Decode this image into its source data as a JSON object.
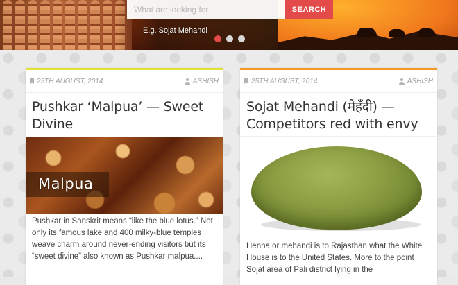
{
  "search": {
    "placeholder": "What are looking for",
    "button_label": "SEARCH",
    "example": "E.g. Sojat Mehandi"
  },
  "slider": {
    "dots": 3,
    "active_index": 0
  },
  "colors": {
    "accent_red": "#e34a4a",
    "card_left_border": "#e2e138",
    "card_right_border": "#f39a27"
  },
  "posts": [
    {
      "date": "25TH AUGUST, 2014",
      "author": "ASHISH",
      "title": "Pushkar ‘Malpua’ — Sweet Divine",
      "image_caption": "Malpua",
      "excerpt": "Pushkar in Sanskrit means “like the blue lotus.” Not only its famous lake and 400 milky-blue temples weave charm around never-ending visitors but its “sweet divine” also known as Pushkar malpua...."
    },
    {
      "date": "25TH AUGUST, 2014",
      "author": "ASHISH",
      "title": "Sojat Mehandi (मेहँदी) — Competitors red with envy",
      "excerpt": "Henna or mehandi is to Rajasthan what the White House is to the United States. More to the point Sojat area of Pali district lying in the"
    }
  ]
}
